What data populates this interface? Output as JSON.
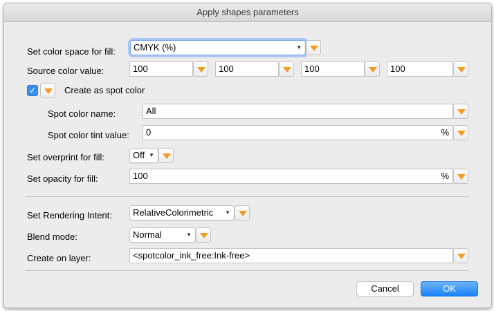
{
  "window": {
    "title": "Apply shapes parameters"
  },
  "fill": {
    "color_space_label": "Set color space for fill:",
    "color_space_value": "CMYK (%)",
    "source_color_label": "Source color value:",
    "source_values": [
      "100",
      "100",
      "100",
      "100"
    ],
    "spot_checkbox_label": "Create as spot color",
    "spot_checked": true,
    "spot_name_label": "Spot color name:",
    "spot_name_value": "All",
    "spot_tint_label": "Spot color tint value:",
    "spot_tint_value": "0",
    "spot_tint_unit": "%",
    "overprint_label": "Set overprint for fill:",
    "overprint_value": "Off",
    "opacity_label": "Set opacity for fill:",
    "opacity_value": "100",
    "opacity_unit": "%"
  },
  "render": {
    "intent_label": "Set Rendering Intent:",
    "intent_value": "RelativeColorimetric",
    "blend_label": "Blend mode:",
    "blend_value": "Normal",
    "layer_label": "Create on layer:",
    "layer_value": "<spotcolor_ink_free:Ink-free>"
  },
  "buttons": {
    "cancel": "Cancel",
    "ok": "OK"
  },
  "icons": {
    "option_button": "orange-down-triangle-icon",
    "popup_chevron": "chevron-updown-icon",
    "check": "checkmark-icon"
  },
  "colors": {
    "accent": "#f49b21",
    "focus_ring": "#a9c8f5",
    "ok_button": "#1a82fb",
    "checkbox": "#3b8eea"
  }
}
